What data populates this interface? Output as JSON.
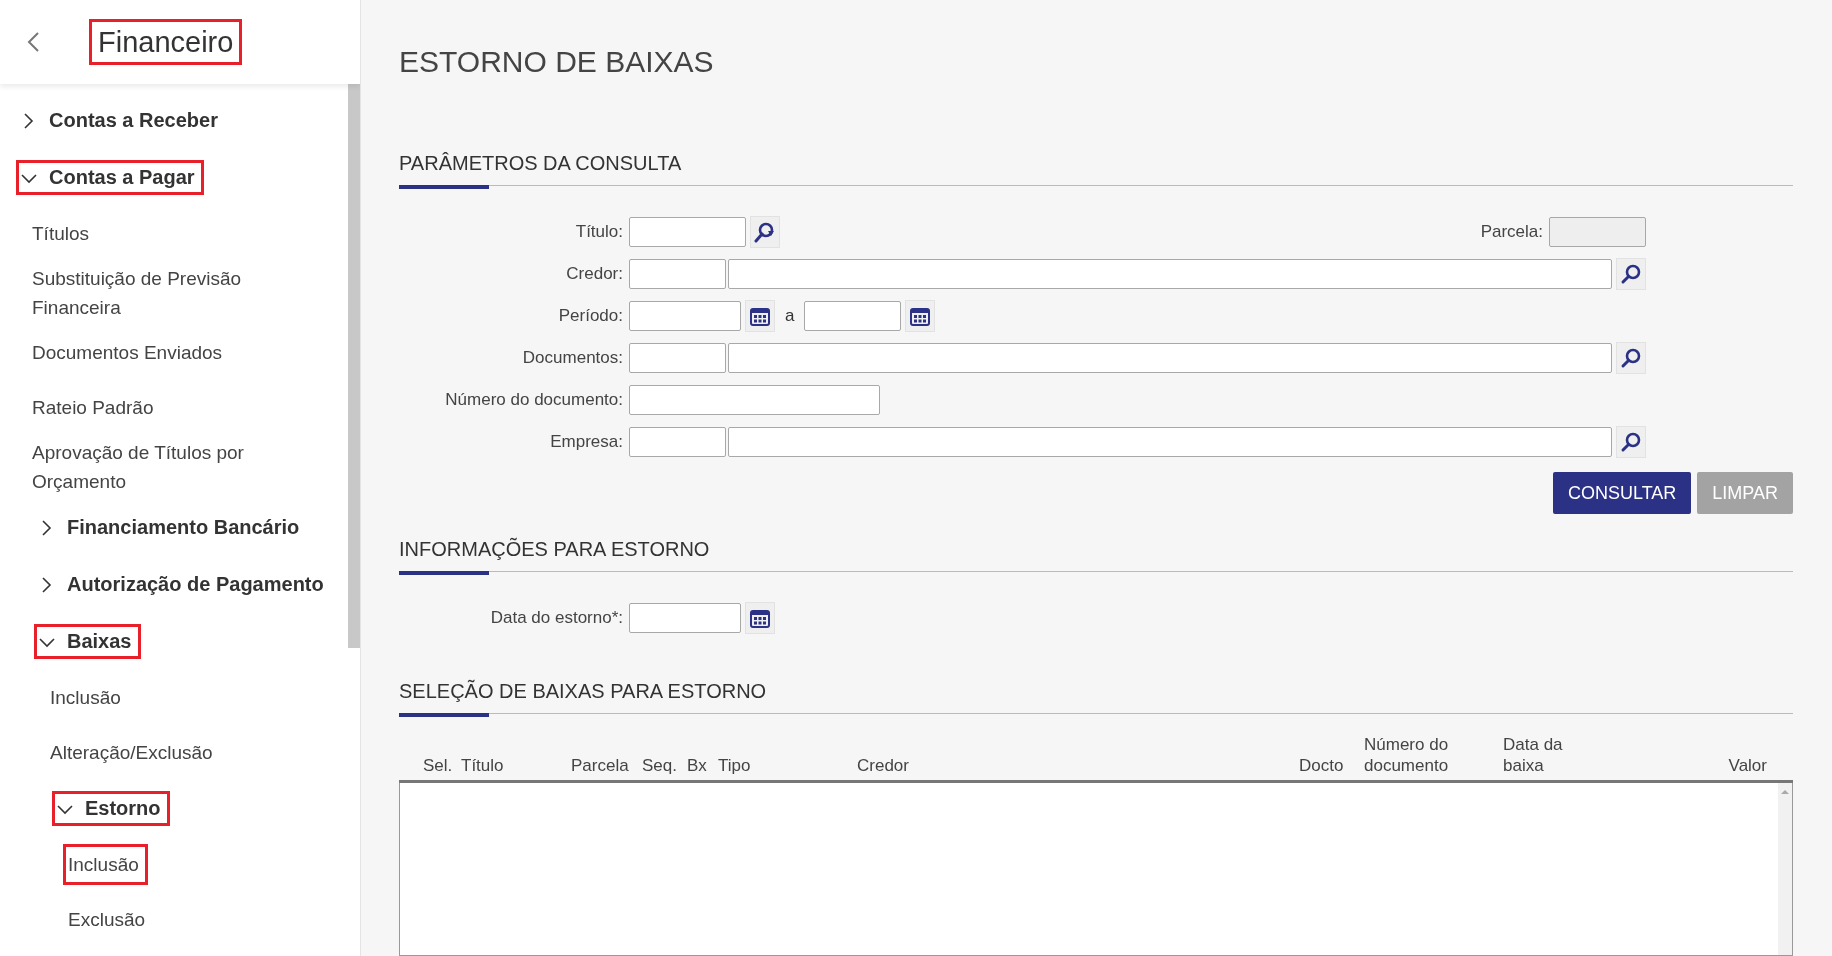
{
  "sidebar": {
    "title": "Financeiro",
    "title_highlighted": true,
    "items": [
      {
        "label": "Contas a Receber",
        "kind": "group",
        "expanded": false,
        "highlighted": false
      },
      {
        "label": "Contas a Pagar",
        "kind": "group",
        "expanded": true,
        "highlighted": true,
        "children": [
          {
            "label": "Títulos",
            "kind": "link",
            "highlighted": false
          },
          {
            "label": "Substituição de Previsão Financeira",
            "kind": "link",
            "highlighted": false
          },
          {
            "label": "Documentos Enviados",
            "kind": "link",
            "highlighted": false
          },
          {
            "label": "Rateio Padrão",
            "kind": "link",
            "highlighted": false
          },
          {
            "label": "Aprovação de Títulos por Orçamento",
            "kind": "link",
            "highlighted": false
          },
          {
            "label": "Financiamento Bancário",
            "kind": "group",
            "expanded": false,
            "highlighted": false
          },
          {
            "label": "Autorização de Pagamento",
            "kind": "group",
            "expanded": false,
            "highlighted": false
          },
          {
            "label": "Baixas",
            "kind": "group",
            "expanded": true,
            "highlighted": true,
            "children": [
              {
                "label": "Inclusão",
                "kind": "link",
                "highlighted": false
              },
              {
                "label": "Alteração/Exclusão",
                "kind": "link",
                "highlighted": false
              },
              {
                "label": "Estorno",
                "kind": "group",
                "expanded": true,
                "highlighted": true,
                "children": [
                  {
                    "label": "Inclusão",
                    "kind": "link",
                    "highlighted": true
                  },
                  {
                    "label": "Exclusão",
                    "kind": "link",
                    "highlighted": false
                  }
                ]
              }
            ]
          }
        ]
      }
    ]
  },
  "page_title": "ESTORNO DE BAIXAS",
  "query_section": {
    "title": "PARÂMETROS DA CONSULTA",
    "rows": [
      {
        "label": "Título:",
        "kind": "lookup",
        "side_label": "Parcela:",
        "side_disabled": true
      },
      {
        "label": "Credor:",
        "kind": "code_name"
      },
      {
        "label": "Período:",
        "kind": "period",
        "separator": "a"
      },
      {
        "label": "Documentos:",
        "kind": "code_name"
      },
      {
        "label": "Número do documento:",
        "kind": "text"
      },
      {
        "label": "Empresa:",
        "kind": "code_name"
      }
    ],
    "buttons": [
      {
        "label": "CONSULTAR",
        "disabled": false
      },
      {
        "label": "LIMPAR",
        "disabled": true
      }
    ]
  },
  "reversal_section": {
    "title": "INFORMAÇÕES PARA ESTORNO",
    "rows": [
      {
        "label": "Data do estorno*:",
        "kind": "date"
      }
    ]
  },
  "selection_section": {
    "title": "SELEÇÃO DE BAIXAS PARA ESTORNO",
    "columns": [
      "Sel.",
      "Título",
      "Parcela",
      "Seq.",
      "Bx",
      "Tipo",
      "Credor",
      "Docto",
      "Número do documento",
      "Data da baixa",
      "Valor"
    ]
  }
}
